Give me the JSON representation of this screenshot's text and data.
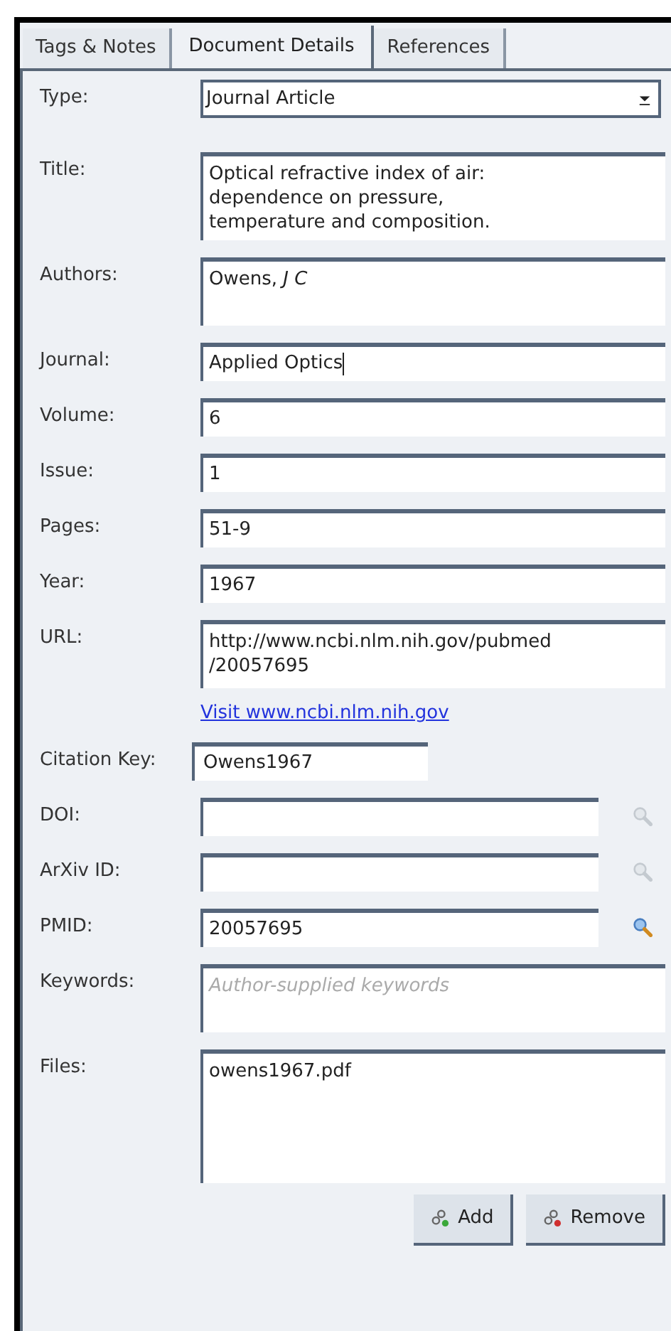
{
  "tabs": [
    {
      "label": "Tags & Notes",
      "selected": false
    },
    {
      "label": "Document Details",
      "selected": true
    },
    {
      "label": "References",
      "selected": false
    }
  ],
  "fields": [
    {
      "kind": "combo",
      "label": "Type:",
      "value": "Journal Article"
    },
    {
      "kind": "area",
      "label": "Title:",
      "value": "Optical refractive index of air:\ndependence on pressure,\ntemperature and composition."
    },
    {
      "kind": "area",
      "label": "Authors:",
      "value": "Owens, *J C*"
    },
    {
      "kind": "line",
      "label": "Journal:",
      "value": "Applied Optics",
      "focused": true
    },
    {
      "kind": "line",
      "label": "Volume:",
      "value": "6"
    },
    {
      "kind": "line",
      "label": "Issue:",
      "value": "1"
    },
    {
      "kind": "line",
      "label": "Pages:",
      "value": "51-9"
    },
    {
      "kind": "line",
      "label": "Year:",
      "value": "1967"
    },
    {
      "kind": "area",
      "label": "URL:",
      "value": "http://www.ncbi.nlm.nih.gov/pubmed\n/20057695"
    },
    {
      "kind": "link",
      "value": "Visit www.ncbi.nlm.nih.gov"
    },
    {
      "kind": "short",
      "label": "Citation Key:",
      "value": "Owens1967"
    },
    {
      "kind": "lookup",
      "label": "DOI:",
      "lookup_enabled": false
    },
    {
      "kind": "lookup",
      "label": "ArXiv ID:",
      "lookup_enabled": false
    },
    {
      "kind": "lookup",
      "label": "PMID:",
      "value": "20057695",
      "lookup_enabled": true
    },
    {
      "kind": "area",
      "label": "Keywords:",
      "placeholder": "Author-supplied keywords"
    },
    {
      "kind": "files",
      "label": "Files:",
      "value": "owens1967.pdf"
    }
  ],
  "buttons": [
    {
      "label": "Add",
      "kind": "add"
    },
    {
      "label": "Remove",
      "kind": "remove"
    }
  ]
}
